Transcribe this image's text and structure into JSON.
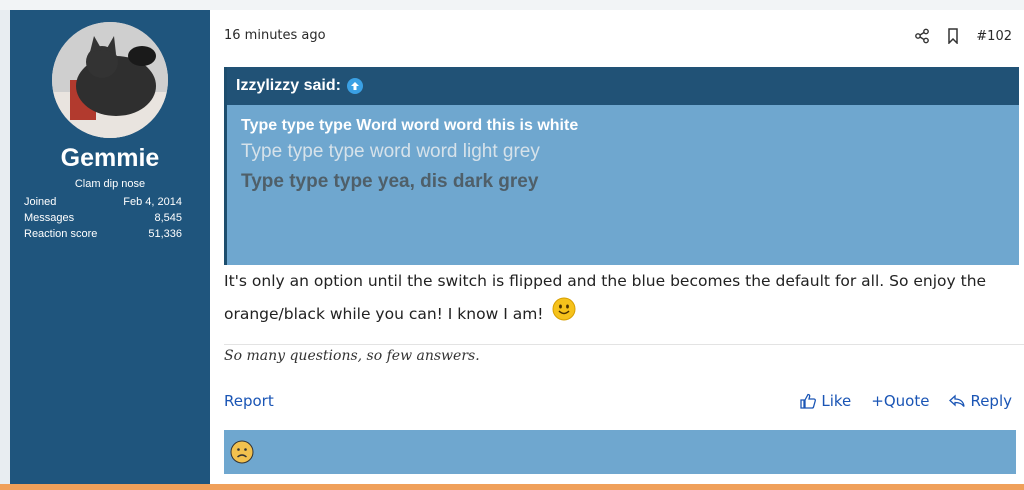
{
  "user": {
    "name": "Gemmie",
    "title": "Clam dip nose",
    "stats": [
      {
        "label": "Joined",
        "value": "Feb 4, 2014"
      },
      {
        "label": "Messages",
        "value": "8,545"
      },
      {
        "label": "Reaction score",
        "value": "51,336"
      }
    ]
  },
  "post": {
    "timestamp": "16 minutes ago",
    "post_number": "#102",
    "share_icon": "share-icon",
    "bookmark_icon": "bookmark-icon",
    "quote": {
      "author_line": "Izzylizzy said:",
      "line1": "Type type type Word word word this is white",
      "line2": "Type type type word word light grey",
      "line3": "Type type type yea, dis dark grey"
    },
    "message": "It's only an option until the switch is flipped and the blue becomes the default for all. So enjoy the orange/black while you can! I know I am!",
    "signature": "So many questions, so few answers.",
    "report_label": "Report",
    "like_label": "Like",
    "quote_label": "+Quote",
    "reply_label": "Reply"
  },
  "colors": {
    "sidebar": "#1f557d",
    "quote_header": "#215276",
    "quote_body": "#6fa7cf",
    "link": "#1a55b5"
  }
}
